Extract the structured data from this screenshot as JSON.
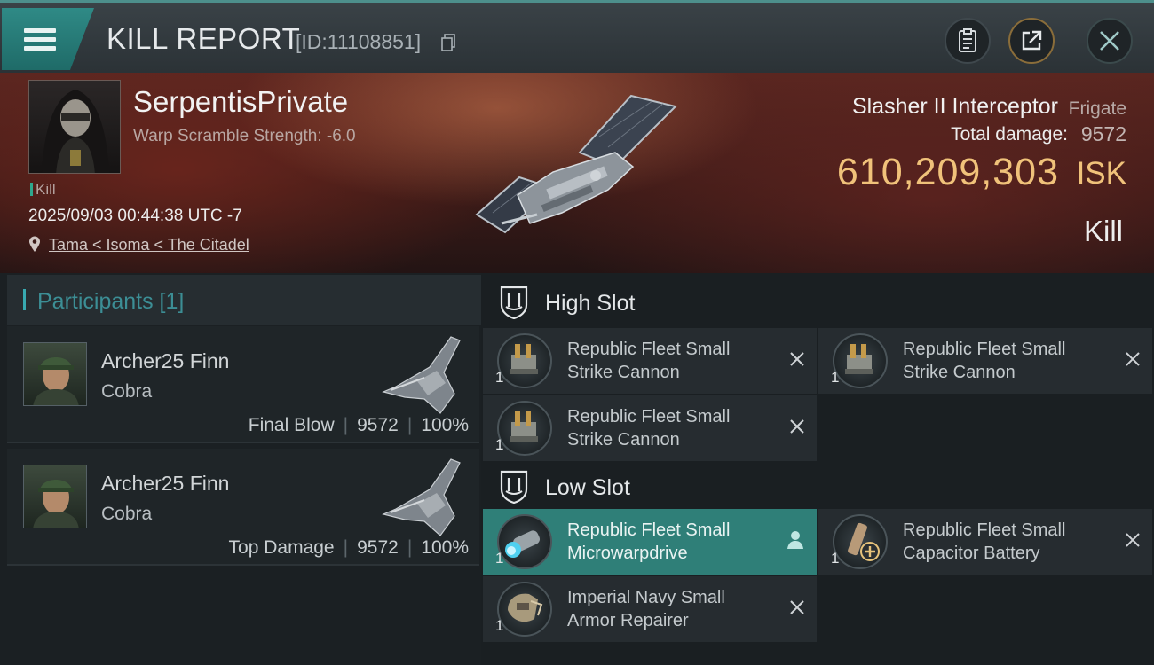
{
  "header": {
    "title": "KILL REPORT",
    "report_id": "[ID:11108851]"
  },
  "victim": {
    "name": "SerpentisPrivate",
    "stat": "Warp Scramble Strength: -6.0",
    "tag": "Kill",
    "timestamp": "2025/09/03 00:44:38 UTC -7",
    "location": "Tama < Isoma < The Citadel"
  },
  "ship": {
    "name": "Slasher II Interceptor",
    "class": "Frigate",
    "damage_label": "Total damage:",
    "damage_value": "9572",
    "isk_value": "610,209,303",
    "isk_unit": "ISK",
    "result": "Kill"
  },
  "participants": {
    "title": "Participants [1]",
    "rows": [
      {
        "name": "Archer25 Finn",
        "ship": "Cobra",
        "role": "Final Blow",
        "damage": "9572",
        "percent": "100%"
      },
      {
        "name": "Archer25 Finn",
        "ship": "Cobra",
        "role": "Top Damage",
        "damage": "9572",
        "percent": "100%"
      }
    ]
  },
  "fitting": {
    "high_slot": {
      "title": "High Slot",
      "modules": [
        {
          "name": "Republic Fleet Small Strike Cannon",
          "qty": "1"
        },
        {
          "name": "Republic Fleet Small Strike Cannon",
          "qty": "1"
        },
        {
          "name": "Republic Fleet Small Strike Cannon",
          "qty": "1"
        }
      ]
    },
    "low_slot": {
      "title": "Low Slot",
      "modules": [
        {
          "name": "Republic Fleet Small Microwarpdrive",
          "qty": "1"
        },
        {
          "name": "Republic Fleet Small Capacitor Battery",
          "qty": "1"
        },
        {
          "name": "Imperial Navy Small Armor Repairer",
          "qty": "1"
        }
      ]
    }
  },
  "icons": {
    "menu": "hamburger-icon",
    "copy": "copy-icon",
    "clipboard": "clipboard-icon",
    "share": "share-icon",
    "close": "close-icon",
    "location": "location-pin-icon",
    "destroyed": "x-icon",
    "fitted_by_player": "person-icon"
  },
  "colors": {
    "accent": "#2f8a86",
    "isk": "#f0c27a",
    "participants_title": "#3c8e95"
  }
}
